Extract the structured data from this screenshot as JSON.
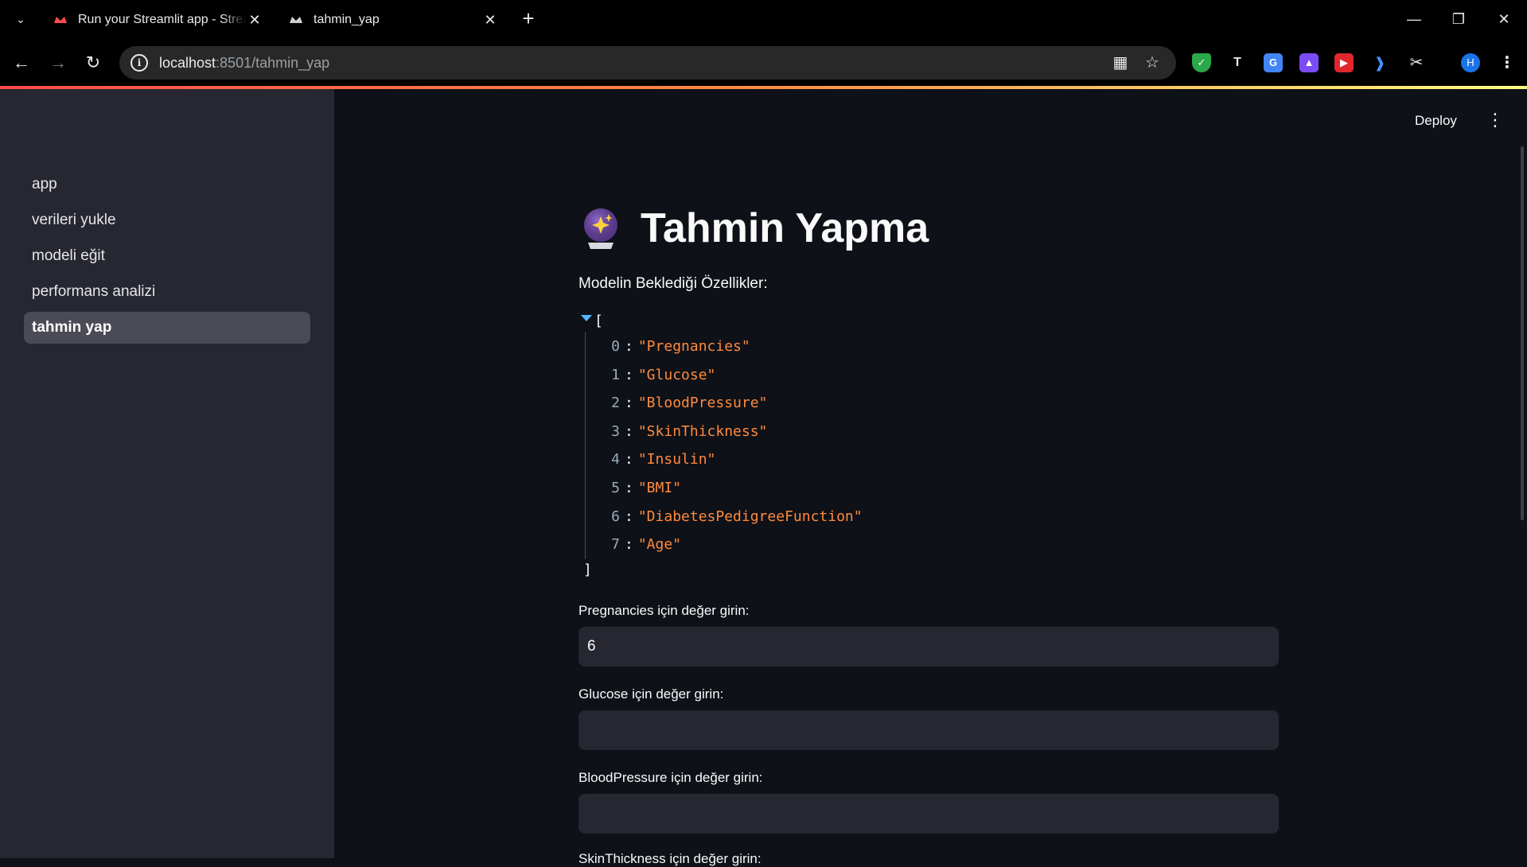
{
  "browser": {
    "tabs": [
      {
        "title": "Run your Streamlit app - Streamlit",
        "favicon": "streamlit-crown-red"
      },
      {
        "title": "tahmin_yap",
        "favicon": "streamlit-crown-white"
      }
    ],
    "url_host": "localhost",
    "url_rest": ":8501/tahmin_yap",
    "profile_initial": "H"
  },
  "sidebar": {
    "items": [
      {
        "label": "app"
      },
      {
        "label": "verileri yukle"
      },
      {
        "label": "modeli eğit"
      },
      {
        "label": "performans analizi"
      },
      {
        "label": "tahmin yap",
        "active": true
      }
    ]
  },
  "header": {
    "deploy_label": "Deploy"
  },
  "main": {
    "title": "Tahmin Yapma",
    "title_icon": "crystal-ball-icon",
    "features_caption": "Modelin Beklediği Özellikler:",
    "json_open": "[",
    "json_close": "]",
    "features": [
      {
        "index": "0",
        "value": "\"Pregnancies\""
      },
      {
        "index": "1",
        "value": "\"Glucose\""
      },
      {
        "index": "2",
        "value": "\"BloodPressure\""
      },
      {
        "index": "3",
        "value": "\"SkinThickness\""
      },
      {
        "index": "4",
        "value": "\"Insulin\""
      },
      {
        "index": "5",
        "value": "\"BMI\""
      },
      {
        "index": "6",
        "value": "\"DiabetesPedigreeFunction\""
      },
      {
        "index": "7",
        "value": "\"Age\""
      }
    ],
    "inputs": [
      {
        "label": "Pregnancies için değer girin:",
        "value": "6"
      },
      {
        "label": "Glucose için değer girin:",
        "value": ""
      },
      {
        "label": "BloodPressure için değer girin:",
        "value": ""
      }
    ],
    "next_label_partial": "SkinThickness için değer girin:"
  },
  "colors": {
    "background": "#0e1117",
    "sidebar": "#262730",
    "input_bg": "#262730",
    "json_value": "#ff8a3d",
    "accent_red": "#ff4b4b"
  }
}
